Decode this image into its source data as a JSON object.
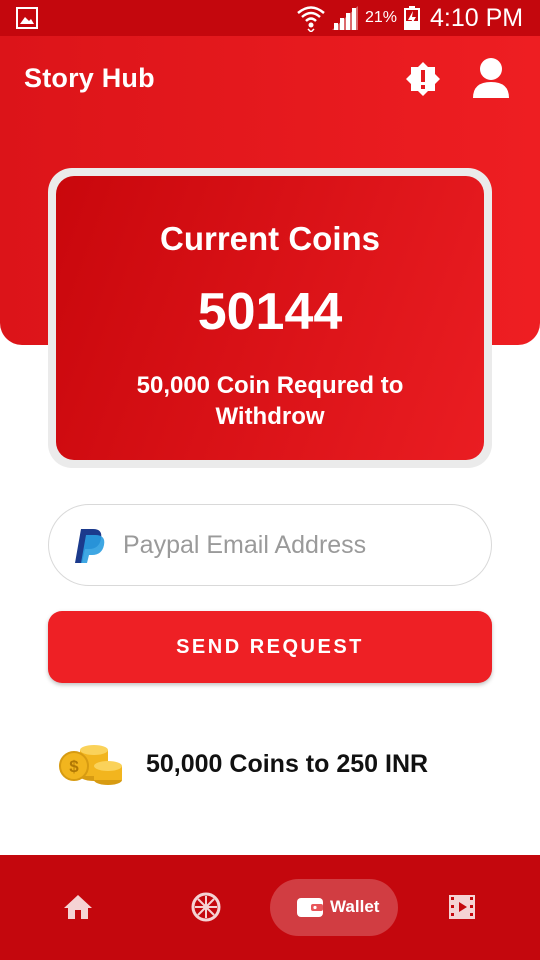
{
  "status_bar": {
    "battery_percent": "21%",
    "time": "4:10 PM"
  },
  "header": {
    "title": "Story Hub",
    "alert_icon": "alert-badge-icon",
    "profile_icon": "person-icon"
  },
  "coin_card": {
    "title": "Current Coins",
    "value": "50144",
    "note": "50,000 Coin Requred to Withdrow"
  },
  "email_field": {
    "placeholder": "Paypal Email Address",
    "value": "",
    "icon": "paypal-icon"
  },
  "send_button": {
    "label": "SEND REQUEST"
  },
  "rate": {
    "icon": "coins-icon",
    "text": "50,000 Coins to 250 INR"
  },
  "bottom_nav": {
    "items": [
      {
        "icon": "home-icon",
        "label": ""
      },
      {
        "icon": "spin-wheel-icon",
        "label": ""
      },
      {
        "icon": "wallet-icon",
        "label": "Wallet",
        "selected": true
      },
      {
        "icon": "video-icon",
        "label": ""
      }
    ]
  },
  "colors": {
    "primary": "#e41a1f",
    "primary_dark": "#c4070d",
    "button": "#ee2025"
  }
}
